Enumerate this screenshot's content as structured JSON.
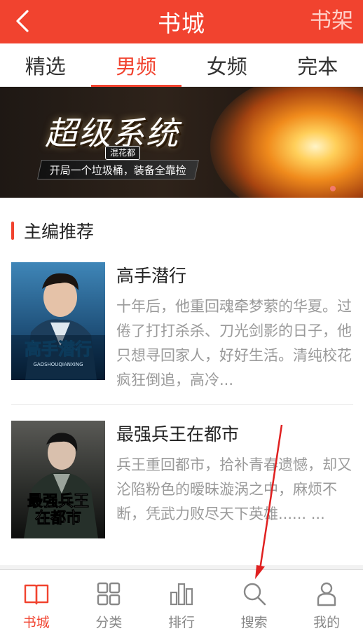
{
  "header": {
    "title": "书城",
    "right_label": "书架",
    "back_icon": "chevron-left-icon",
    "bg_color": "#f1432f"
  },
  "tabs": [
    {
      "label": "精选",
      "active": false
    },
    {
      "label": "男频",
      "active": true
    },
    {
      "label": "女频",
      "active": false
    },
    {
      "label": "完本",
      "active": false
    }
  ],
  "banner": {
    "title": "超级系统",
    "badge": "混花都",
    "tagline": "开局一个垃圾桶，装备全靠捡"
  },
  "section": {
    "title": "主编推荐"
  },
  "books": [
    {
      "title": "高手潜行",
      "description": "十年后，他重回魂牵梦萦的华夏。过倦了打打杀杀、刀光剑影的日子，他只想寻回家人，好好生活。清纯校花疯狂倒追，高冷...",
      "cover_text": "高手潜行",
      "cover_subtext": "GAOSHOUQIANXING"
    },
    {
      "title": "最强兵王在都市",
      "description": "兵王重回都市，拾补青春遗憾，却又沦陷粉色的暧昧漩涡之中，麻烦不断，凭武力败尽天下英雄...... ...",
      "cover_text": "最强兵王在都市"
    }
  ],
  "bottom_nav": [
    {
      "label": "书城",
      "icon": "book-icon",
      "active": true
    },
    {
      "label": "分类",
      "icon": "grid-icon",
      "active": false
    },
    {
      "label": "排行",
      "icon": "bar-chart-icon",
      "active": false
    },
    {
      "label": "搜索",
      "icon": "search-icon",
      "active": false
    },
    {
      "label": "我的",
      "icon": "person-icon",
      "active": false
    }
  ],
  "colors": {
    "accent": "#f1432f",
    "text_muted": "#9a9a9a",
    "annotation_arrow": "#e02020"
  }
}
